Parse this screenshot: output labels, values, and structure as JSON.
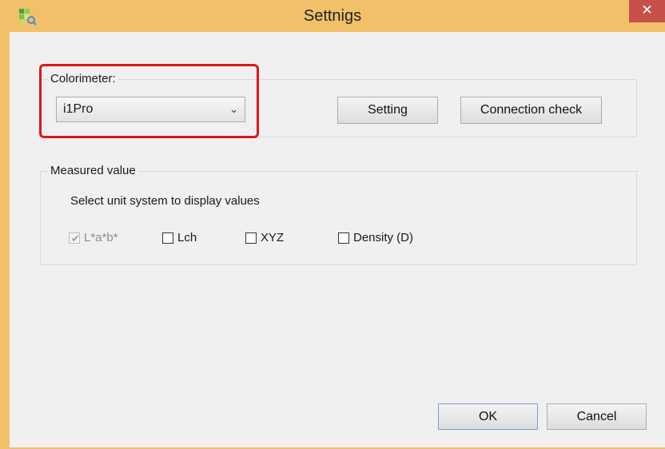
{
  "window": {
    "title": "Settnigs",
    "close_glyph": "✕"
  },
  "colorimeter": {
    "group_label": "Colorimeter:",
    "selected": "i1Pro",
    "setting_button": "Setting",
    "connection_check_button": "Connection check"
  },
  "measured_value": {
    "group_label": "Measured value",
    "instruction": "Select unit system to display values",
    "options": [
      {
        "label": "L*a*b*",
        "checked": true,
        "enabled": false
      },
      {
        "label": "Lch",
        "checked": false,
        "enabled": true
      },
      {
        "label": "XYZ",
        "checked": false,
        "enabled": true
      },
      {
        "label": "Density (D)",
        "checked": false,
        "enabled": true
      }
    ]
  },
  "footer": {
    "ok_button": "OK",
    "cancel_button": "Cancel"
  },
  "colors": {
    "frame": "#f1c069",
    "close_button": "#c7504b",
    "highlight": "#e0141d",
    "client_bg": "#f0f0f0"
  }
}
